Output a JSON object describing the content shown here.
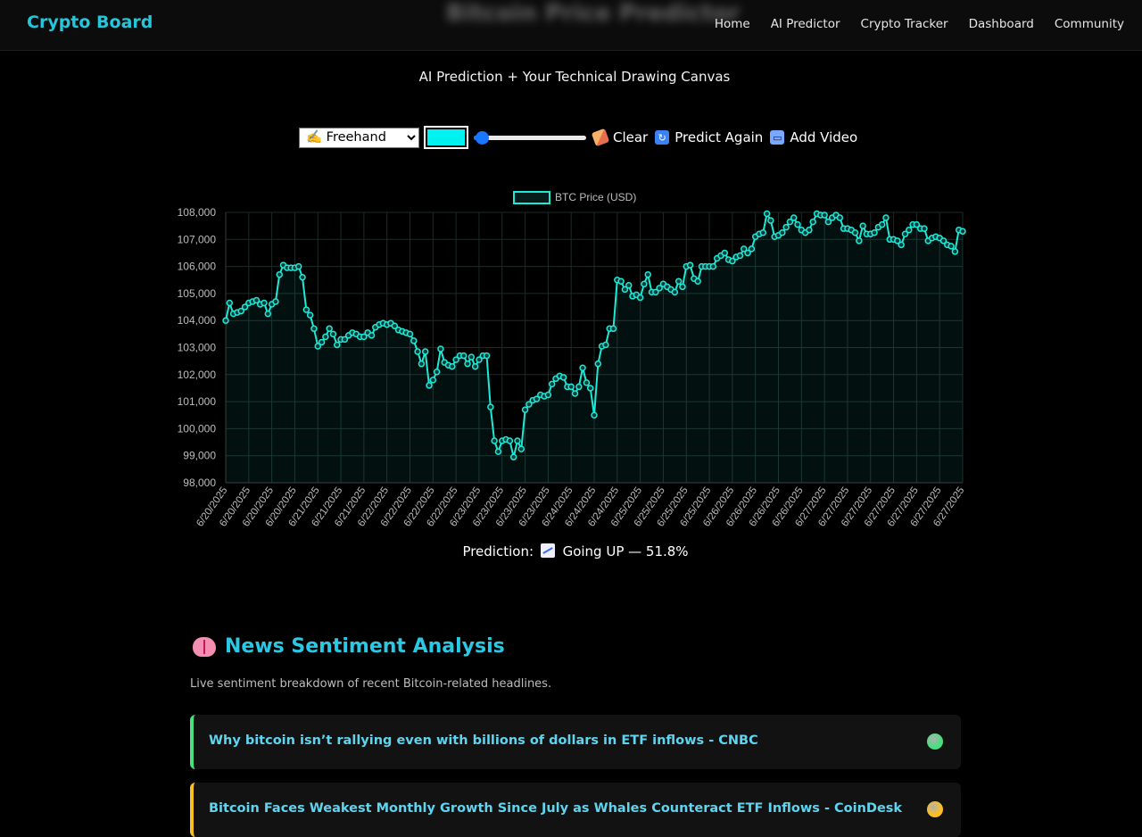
{
  "nav": {
    "brand": "Crypto Board",
    "blurred_title": "Bitcoin Price Predictor",
    "links": [
      "Home",
      "AI Predictor",
      "Crypto Tracker",
      "Dashboard",
      "Community"
    ]
  },
  "subtitle": "AI Prediction + Your Technical Drawing Canvas",
  "toolbar": {
    "tool_selected": "✍️ Freehand",
    "pen_color": "#00f2f0",
    "clear_label": "Clear",
    "predict_label": "Predict Again",
    "video_label": "Add Video"
  },
  "chart_data": {
    "type": "line",
    "legend": "BTC Price (USD)",
    "ylim": [
      98000,
      108000
    ],
    "yticks": [
      "108,000",
      "107,000",
      "106,000",
      "105,000",
      "104,000",
      "103,000",
      "102,000",
      "101,000",
      "100,000",
      "99,000",
      "98,000"
    ],
    "xticks": [
      "6/20/2025",
      "6/20/2025",
      "6/20/2025",
      "6/20/2025",
      "6/21/2025",
      "6/21/2025",
      "6/21/2025",
      "6/22/2025",
      "6/22/2025",
      "6/22/2025",
      "6/22/2025",
      "6/23/2025",
      "6/23/2025",
      "6/23/2025",
      "6/23/2025",
      "6/24/2025",
      "6/24/2025",
      "6/24/2025",
      "6/25/2025",
      "6/25/2025",
      "6/25/2025",
      "6/25/2025",
      "6/26/2025",
      "6/26/2025",
      "6/26/2025",
      "6/26/2025",
      "6/27/2025",
      "6/27/2025",
      "6/27/2025",
      "6/27/2025",
      "6/27/2025",
      "6/27/2025",
      "6/27/2025"
    ],
    "values": [
      104000,
      104650,
      104250,
      104300,
      104350,
      104500,
      104650,
      104700,
      104750,
      104600,
      104650,
      104250,
      104600,
      104700,
      105700,
      106050,
      105950,
      105950,
      105950,
      106000,
      105600,
      104400,
      104200,
      103700,
      103050,
      103200,
      103400,
      103700,
      103500,
      103100,
      103300,
      103300,
      103450,
      103550,
      103500,
      103400,
      103400,
      103550,
      103450,
      103750,
      103850,
      103900,
      103850,
      103900,
      103800,
      103650,
      103600,
      103550,
      103500,
      103250,
      102850,
      102400,
      102850,
      101600,
      101800,
      102100,
      102950,
      102450,
      102350,
      102300,
      102550,
      102700,
      102700,
      102400,
      102650,
      102300,
      102550,
      102700,
      102700,
      100800,
      99550,
      99150,
      99550,
      99600,
      99550,
      98950,
      99550,
      99250,
      100700,
      100900,
      101050,
      101100,
      101250,
      101200,
      101250,
      101650,
      101850,
      101950,
      101900,
      101550,
      101550,
      101300,
      101550,
      102250,
      101700,
      101500,
      100500,
      102400,
      103050,
      103100,
      103700,
      103700,
      105500,
      105450,
      105150,
      105300,
      104900,
      104950,
      104850,
      105350,
      105700,
      105050,
      105050,
      105200,
      105350,
      105250,
      105150,
      105050,
      105450,
      105250,
      106000,
      106050,
      105550,
      105450,
      106000,
      106000,
      106000,
      106000,
      106300,
      106400,
      106500,
      106250,
      106200,
      106350,
      106400,
      106650,
      106500,
      106650,
      107100,
      107200,
      107250,
      107950,
      107700,
      107100,
      107150,
      107250,
      107450,
      107650,
      107800,
      107550,
      107350,
      107250,
      107350,
      107650,
      107950,
      107900,
      107900,
      107650,
      107800,
      107900,
      107800,
      107400,
      107400,
      107350,
      107250,
      106950,
      107500,
      107200,
      107200,
      107250,
      107450,
      107550,
      107800,
      107000,
      107000,
      106950,
      106800,
      107200,
      107350,
      107550,
      107550,
      107400,
      107400,
      106950,
      107050,
      107100,
      107050,
      106950,
      106800,
      106750,
      106550,
      107350,
      107300
    ]
  },
  "prediction": {
    "label": "Prediction:",
    "text": "Going UP — 51.8%"
  },
  "news": {
    "title": "News Sentiment Analysis",
    "description": "Live sentiment breakdown of recent Bitcoin-related headlines.",
    "items": [
      {
        "headline": "Why bitcoin isn’t rallying even with billions of dollars in ETF inflows - CNBC",
        "sentiment_color": "#4ade80"
      },
      {
        "headline": "Bitcoin Faces Weakest Monthly Growth Since July as Whales Counteract ETF Inflows - CoinDesk",
        "sentiment_color": "#fbbf24"
      }
    ]
  },
  "colors": {
    "accent": "#26c6da",
    "line": "#1de9d6",
    "positive": "#4ade80",
    "neutral": "#fbbf24"
  }
}
